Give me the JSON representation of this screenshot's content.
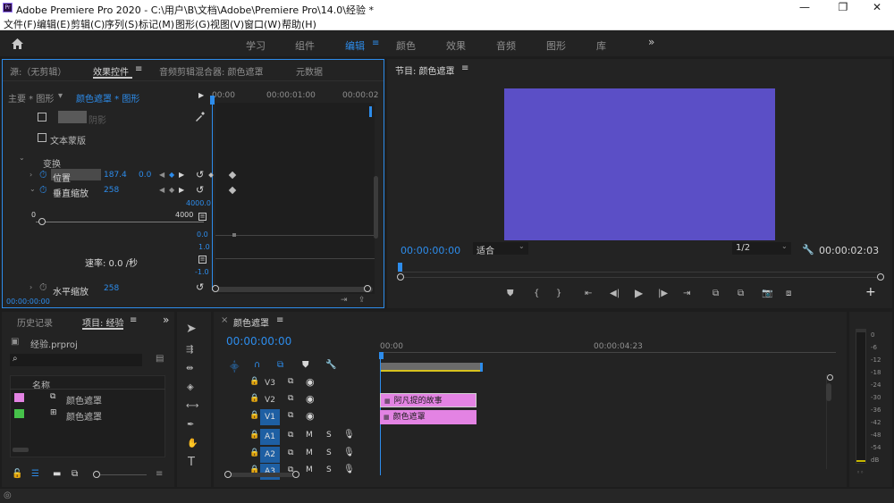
{
  "window": {
    "title": "Adobe Premiere Pro 2020 - C:\\用户\\B\\文档\\Adobe\\Premiere Pro\\14.0\\经验 *",
    "app_icon": "Pr",
    "minimize": "—",
    "restore": "❐",
    "close": "✕"
  },
  "menu": [
    "文件(F)",
    "编辑(E)",
    "剪辑(C)",
    "序列(S)",
    "标记(M)",
    "图形(G)",
    "视图(V)",
    "窗口(W)",
    "帮助(H)"
  ],
  "workspaces": {
    "items": [
      "学习",
      "组件",
      "编辑",
      "颜色",
      "效果",
      "音频",
      "图形",
      "库"
    ],
    "active": "编辑",
    "more": "»"
  },
  "source_panel": {
    "tabs": [
      "源:（无剪辑）",
      "效果控件",
      "音频剪辑混合器: 颜色遮罩",
      "元数据"
    ],
    "active_tab": "效果控件",
    "master": "主要 * 图形",
    "clip": "颜色遮罩 * 图形",
    "ruler": [
      "00:00",
      "00:00:01:00",
      "00:00:02"
    ],
    "shadow_label": "阴影",
    "text_mask": "文本蒙版",
    "transform": "变换",
    "position_label": "位置",
    "position_x": "187.4",
    "position_y": "0.0",
    "vscale_label": "垂直缩放",
    "vscale_value": "258",
    "slider_min": "0",
    "slider_max": "4000",
    "graph_top": "4000.0",
    "graph_zero": "0.0",
    "rate_top": "1.0",
    "rate_label": "速率: 0.0 /秒",
    "rate_bottom": "-1.0",
    "hscale_label": "水平缩放",
    "hscale_value": "258",
    "timecode": "00:00:00:00"
  },
  "program_panel": {
    "title": "节目: 颜色遮罩",
    "timecode": "00:00:00:00",
    "fit": "适合",
    "resolution": "1/2",
    "duration": "00:00:02:03",
    "frame_color": "#5b4fc6"
  },
  "project_panel": {
    "tabs": [
      "历史记录",
      "项目: 经验"
    ],
    "active_tab": "项目: 经验",
    "project_file": "经验.prproj",
    "search_placeholder": "",
    "column_name": "名称",
    "items": [
      {
        "name": "颜色遮罩",
        "color": "#e383e3",
        "icon": "sequence-icon"
      },
      {
        "name": "颜色遮罩",
        "color": "#46c24a",
        "icon": "color-matte-icon"
      }
    ]
  },
  "tools": [
    "selection-tool",
    "track-select-tool",
    "ripple-edit-tool",
    "razor-tool",
    "slip-tool",
    "pen-tool",
    "hand-tool",
    "type-tool"
  ],
  "timeline": {
    "tab": "颜色遮罩",
    "timecode": "00:00:00:00",
    "ruler": [
      "00:00",
      "00:00:04:23"
    ],
    "tracks": [
      {
        "name": "V3",
        "type": "video",
        "target": false
      },
      {
        "name": "V2",
        "type": "video",
        "target": false
      },
      {
        "name": "V1",
        "type": "video",
        "target": true
      },
      {
        "name": "A1",
        "type": "audio",
        "target": true
      },
      {
        "name": "A2",
        "type": "audio",
        "target": true
      },
      {
        "name": "A3",
        "type": "audio",
        "target": true
      }
    ],
    "audio_mute": "M",
    "audio_solo": "S",
    "clips": [
      {
        "track": "V2",
        "label": "阿凡提的故事",
        "color": "#e383e3"
      },
      {
        "track": "V1",
        "label": "颜色遮罩",
        "color": "#e383e3"
      }
    ],
    "meter_labels": [
      "0",
      "-6",
      "-12",
      "-18",
      "-24",
      "-30",
      "-36",
      "-42",
      "-48",
      "-54",
      "dB"
    ]
  }
}
